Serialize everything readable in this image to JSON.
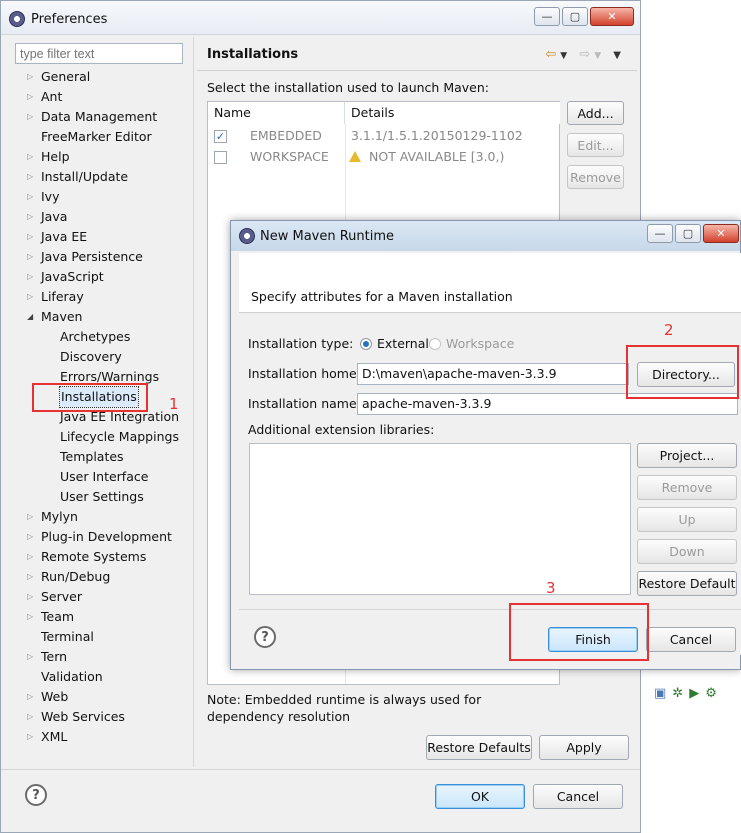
{
  "window": {
    "title": "Preferences",
    "min_icon": "minimize-icon",
    "max_icon": "maximize-icon",
    "close_icon": "close-icon"
  },
  "filter": {
    "placeholder": "type filter text"
  },
  "tree": {
    "items": [
      {
        "label": "General",
        "expandable": true
      },
      {
        "label": "Ant",
        "expandable": true
      },
      {
        "label": "Data Management",
        "expandable": true
      },
      {
        "label": "FreeMarker Editor",
        "expandable": false
      },
      {
        "label": "Help",
        "expandable": true
      },
      {
        "label": "Install/Update",
        "expandable": true
      },
      {
        "label": "Ivy",
        "expandable": true
      },
      {
        "label": "Java",
        "expandable": true
      },
      {
        "label": "Java EE",
        "expandable": true
      },
      {
        "label": "Java Persistence",
        "expandable": true
      },
      {
        "label": "JavaScript",
        "expandable": true
      },
      {
        "label": "Liferay",
        "expandable": true
      },
      {
        "label": "Maven",
        "expandable": true,
        "expanded": true
      },
      {
        "label": "Archetypes",
        "child": true
      },
      {
        "label": "Discovery",
        "child": true
      },
      {
        "label": "Errors/Warnings",
        "child": true
      },
      {
        "label": "Installations",
        "child": true,
        "selected": true
      },
      {
        "label": "Java EE Integration",
        "child": true
      },
      {
        "label": "Lifecycle Mappings",
        "child": true
      },
      {
        "label": "Templates",
        "child": true
      },
      {
        "label": "User Interface",
        "child": true
      },
      {
        "label": "User Settings",
        "child": true
      },
      {
        "label": "Mylyn",
        "expandable": true
      },
      {
        "label": "Plug-in Development",
        "expandable": true
      },
      {
        "label": "Remote Systems",
        "expandable": true
      },
      {
        "label": "Run/Debug",
        "expandable": true
      },
      {
        "label": "Server",
        "expandable": true
      },
      {
        "label": "Team",
        "expandable": true
      },
      {
        "label": "Terminal",
        "expandable": false
      },
      {
        "label": "Tern",
        "expandable": true
      },
      {
        "label": "Validation",
        "expandable": false
      },
      {
        "label": "Web",
        "expandable": true
      },
      {
        "label": "Web Services",
        "expandable": true
      },
      {
        "label": "XML",
        "expandable": true
      }
    ]
  },
  "page": {
    "title": "Installations",
    "instruction": "Select the installation used to launch Maven:",
    "columns": {
      "name": "Name",
      "details": "Details"
    },
    "rows": [
      {
        "checked": true,
        "name": "EMBEDDED",
        "details": "3.1.1/1.5.1.20150129-1102"
      },
      {
        "checked": false,
        "name": "WORKSPACE",
        "details": "NOT AVAILABLE [3.0,)",
        "warning": true
      }
    ],
    "buttons": {
      "add": "Add...",
      "edit": "Edit...",
      "remove": "Remove"
    },
    "note": "Note: Embedded runtime is always used for dependency resolution",
    "restore_defaults": "Restore Defaults",
    "apply": "Apply"
  },
  "footer": {
    "ok": "OK",
    "cancel": "Cancel"
  },
  "dialog": {
    "title": "New Maven Runtime",
    "description": "Specify attributes for a Maven installation",
    "type_label": "Installation type:",
    "type_external": "External",
    "type_workspace": "Workspace",
    "home_label": "Installation home:",
    "home_value": "D:\\maven\\apache-maven-3.3.9",
    "directory": "Directory...",
    "name_label": "Installation name:",
    "name_value": "apache-maven-3.3.9",
    "libs_label": "Additional extension libraries:",
    "buttons": {
      "project": "Project...",
      "remove": "Remove",
      "up": "Up",
      "down": "Down",
      "restore_default": "Restore Default"
    },
    "finish": "Finish",
    "cancel": "Cancel"
  },
  "annotations": {
    "one": "1",
    "two": "2",
    "three": "3"
  },
  "colors": {
    "annotation_red": "#e53333",
    "default_button_blue": "#3c8fd6"
  }
}
